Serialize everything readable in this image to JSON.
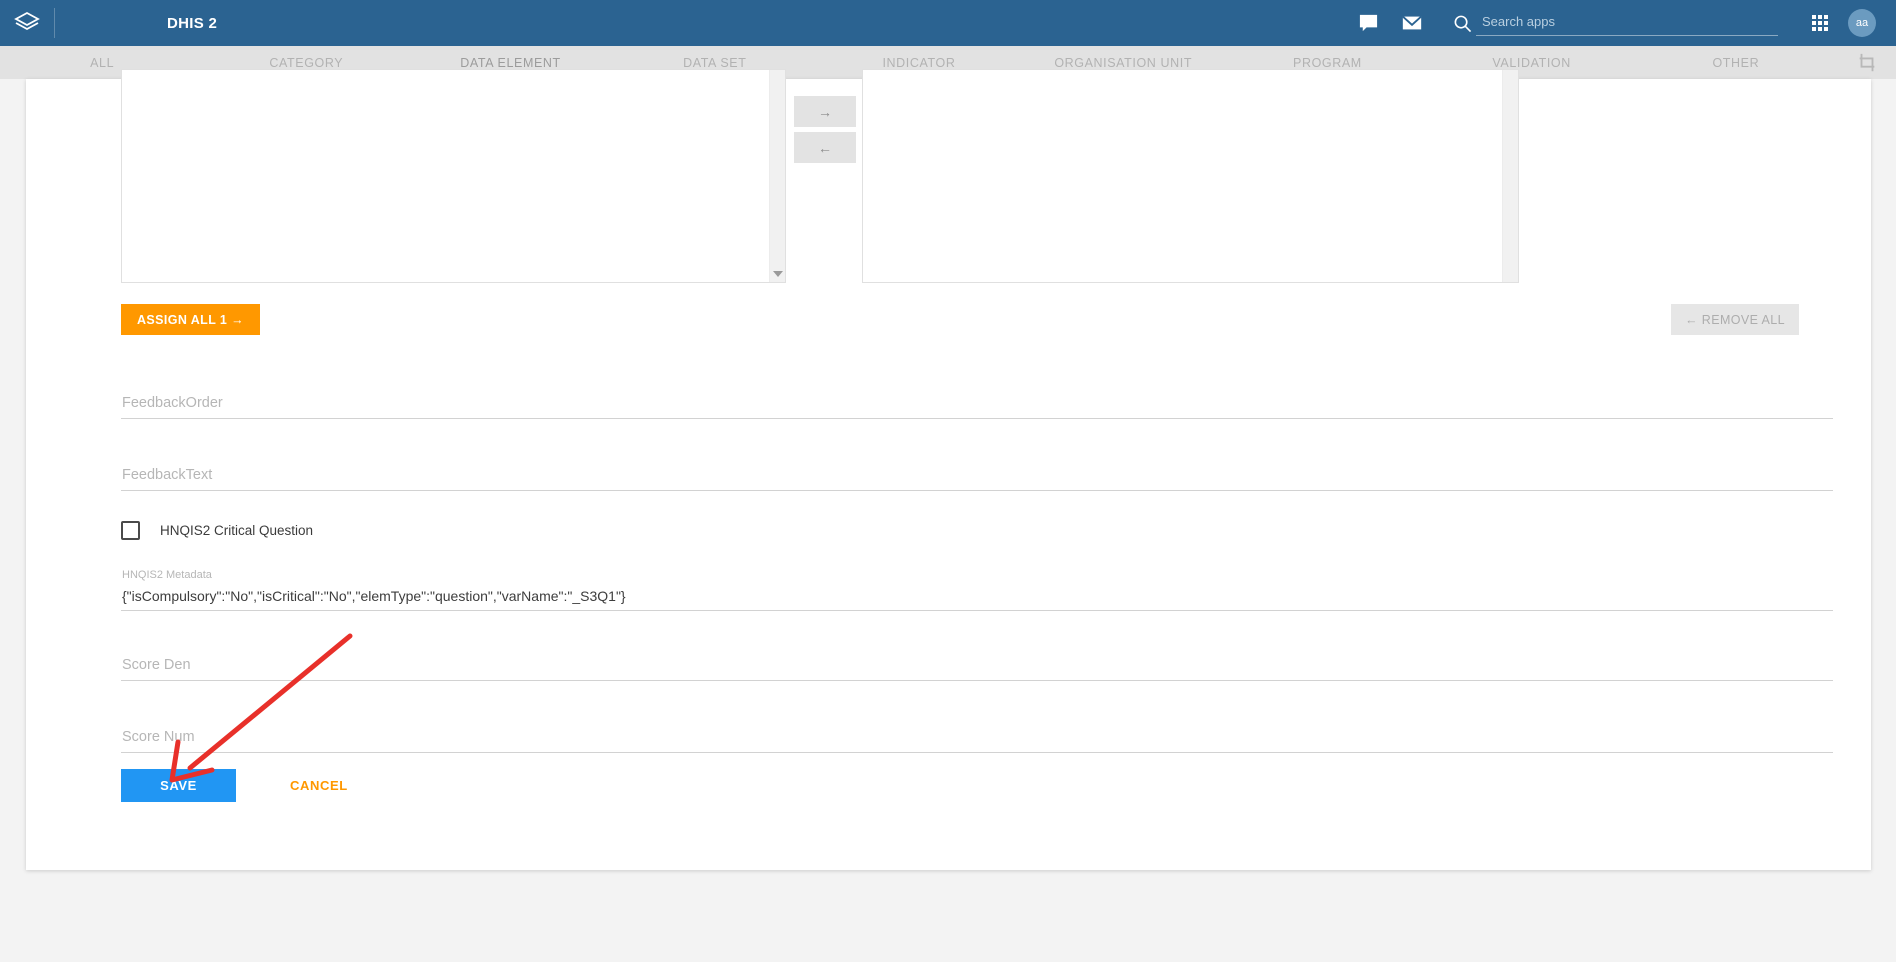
{
  "header": {
    "title": "DHIS 2",
    "logo_icon": "dhis2-layers-logo-icon",
    "messages_icon": "message-icon",
    "mail_icon": "mail-icon",
    "search_icon": "search-icon",
    "apps_icon": "apps-grid-icon",
    "search": {
      "value": "",
      "placeholder": "Search apps"
    },
    "avatar_initials": "aa",
    "colors": {
      "bar": "#2b6391",
      "avatar": "#6b9bc0"
    }
  },
  "tabs": {
    "items": [
      {
        "label": "ALL",
        "active": false
      },
      {
        "label": "CATEGORY",
        "active": false
      },
      {
        "label": "DATA ELEMENT",
        "active": true
      },
      {
        "label": "DATA SET",
        "active": false
      },
      {
        "label": "INDICATOR",
        "active": false
      },
      {
        "label": "ORGANISATION UNIT",
        "active": false
      },
      {
        "label": "PROGRAM",
        "active": false
      },
      {
        "label": "VALIDATION",
        "active": false
      },
      {
        "label": "OTHER",
        "active": false
      }
    ],
    "corner_icon": "crop-expand-icon",
    "active_underline_color": "#ff9800"
  },
  "transfer": {
    "move_right_label": "→",
    "move_left_label": "←",
    "left_items": [],
    "right_items": [],
    "scroll_down_icon": "scroll-down-arrow-icon"
  },
  "actions": {
    "assign_all_label": "ASSIGN ALL 1 →",
    "assign_all_color": "#ff9800",
    "remove_all_label": "← REMOVE ALL",
    "remove_all_disabled": true
  },
  "form": {
    "feedback_order": {
      "placeholder": "FeedbackOrder",
      "value": ""
    },
    "feedback_text": {
      "placeholder": "FeedbackText",
      "value": ""
    },
    "critical_question": {
      "label": "HNQIS2 Critical Question",
      "checked": false
    },
    "metadata": {
      "label": "HNQIS2 Metadata",
      "value": "{\"isCompulsory\":\"No\",\"isCritical\":\"No\",\"elemType\":\"question\",\"varName\":\"_S3Q1\"}"
    },
    "score_den": {
      "placeholder": "Score Den",
      "value": ""
    },
    "score_num": {
      "placeholder": "Score Num",
      "value": ""
    }
  },
  "footer": {
    "save_label": "SAVE",
    "cancel_label": "CANCEL",
    "save_color": "#2196f3",
    "cancel_color": "#ff9800"
  },
  "annotation": {
    "type": "arrow",
    "color": "#e8302a",
    "points_to": "save-button"
  }
}
